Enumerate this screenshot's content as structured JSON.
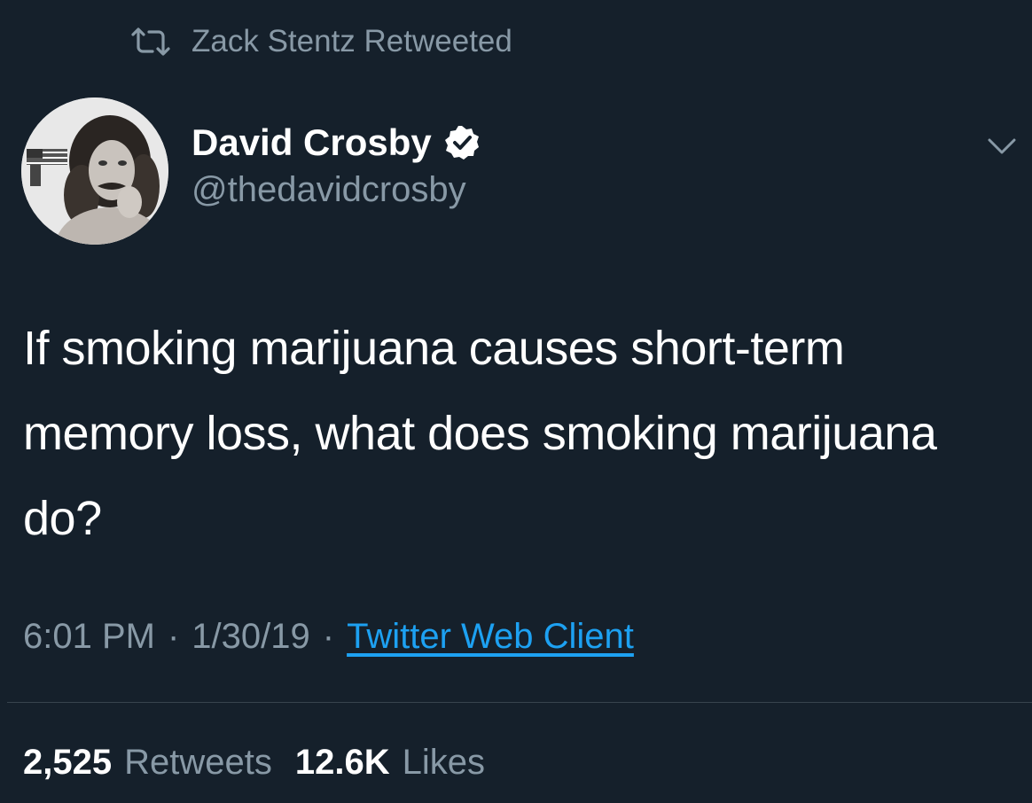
{
  "retweet_context": {
    "icon": "retweet-icon",
    "text": "Zack Stentz Retweeted"
  },
  "author": {
    "display_name": "David Crosby",
    "verified": true,
    "verified_icon": "verified-badge-icon",
    "handle": "@thedavidcrosby"
  },
  "tweet": {
    "text": "If smoking marijuana causes short-term memory loss, what does smoking marijuana do?",
    "time": "6:01 PM",
    "date": "1/30/19",
    "separator": "·",
    "source": "Twitter Web Client"
  },
  "stats": {
    "retweets_count": "2,525",
    "retweets_label": "Retweets",
    "likes_count": "12.6K",
    "likes_label": "Likes"
  },
  "colors": {
    "background": "#15202b",
    "primary_text": "#ffffff",
    "secondary_text": "#8899a6",
    "link": "#1da1f2",
    "divider": "#38444d"
  }
}
